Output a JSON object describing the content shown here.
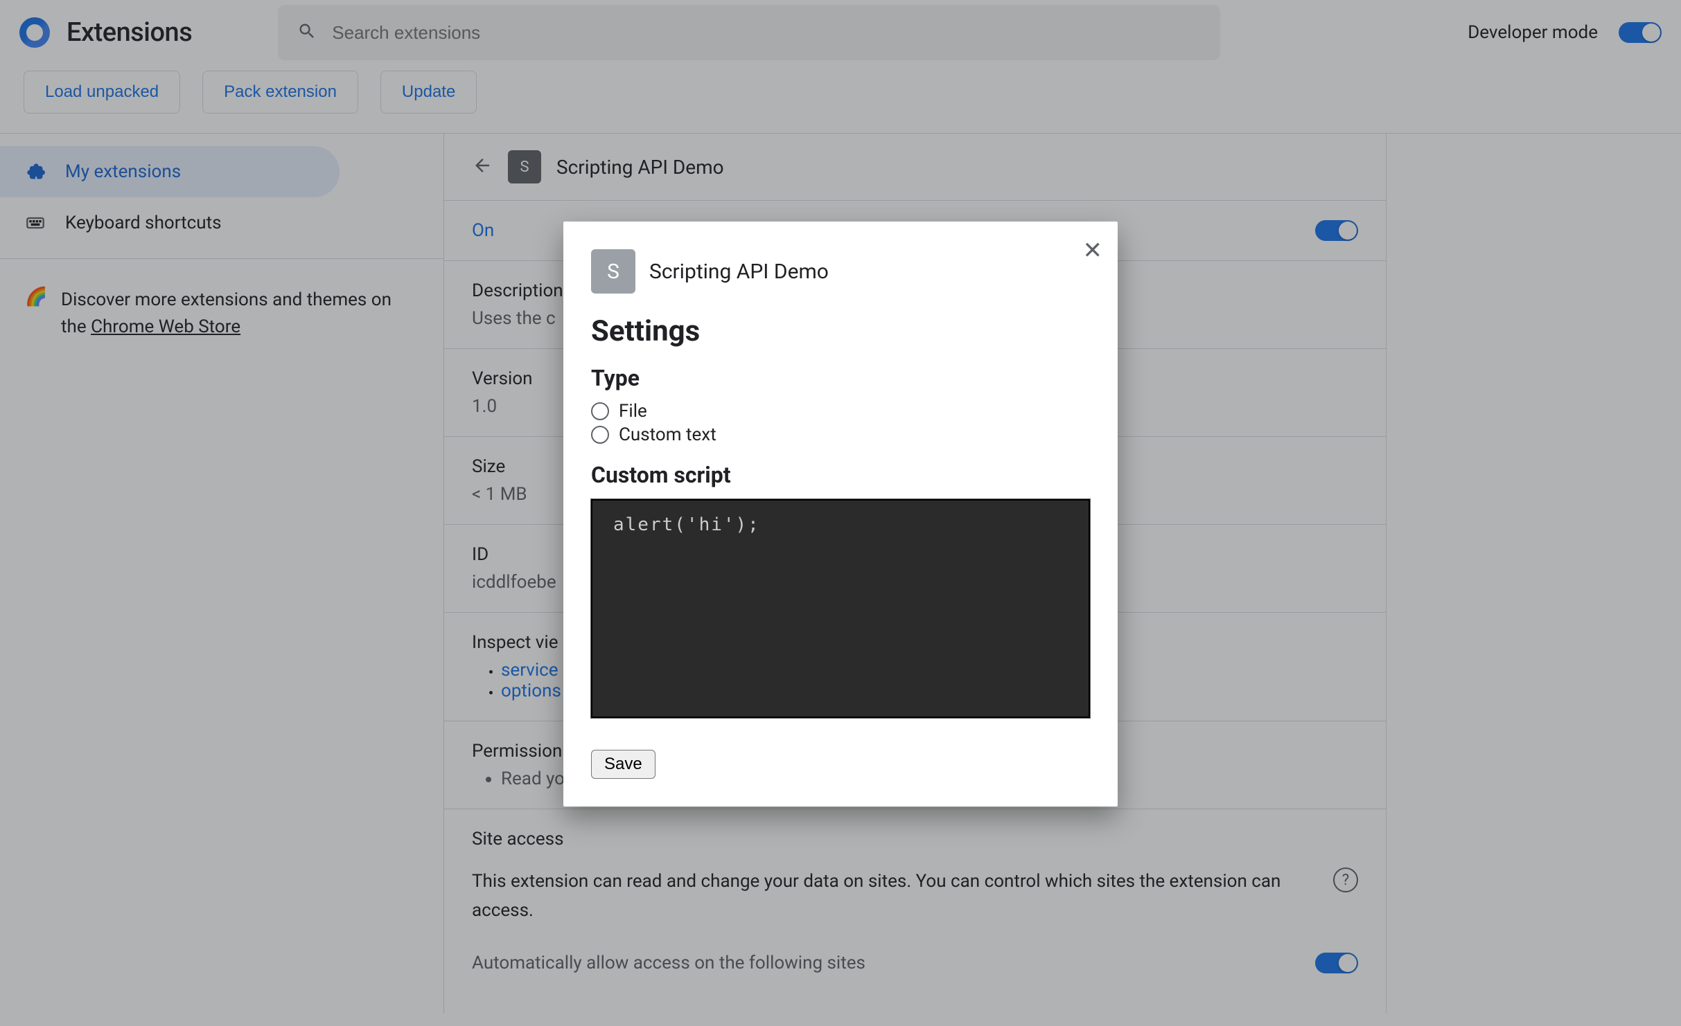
{
  "header": {
    "title": "Extensions",
    "search_placeholder": "Search extensions",
    "dev_mode_label": "Developer mode"
  },
  "buttons": {
    "load_unpacked": "Load unpacked",
    "pack_extension": "Pack extension",
    "update": "Update"
  },
  "sidebar": {
    "my_extensions": "My extensions",
    "keyboard_shortcuts": "Keyboard shortcuts",
    "cws_prefix": "Discover more extensions and themes on the ",
    "cws_link": "Chrome Web Store"
  },
  "detail": {
    "name": "Scripting API Demo",
    "badge_letter": "S",
    "on_label": "On",
    "description_label": "Description",
    "description_value": "Uses the c",
    "version_label": "Version",
    "version_value": "1.0",
    "size_label": "Size",
    "size_value": "< 1 MB",
    "id_label": "ID",
    "id_value": "icddlfoebe",
    "inspect_label": "Inspect vie",
    "inspect_items": [
      "service",
      "options"
    ],
    "permissions_label": "Permission",
    "permissions_item": "Read yo",
    "site_access_label": "Site access",
    "site_access_text": "This extension can read and change your data on sites. You can control which sites the extension can access.",
    "auto_allow_label": "Automatically allow access on the following sites"
  },
  "dialog": {
    "badge_letter": "S",
    "name": "Scripting API Demo",
    "title": "Settings",
    "type_heading": "Type",
    "type_file": "File",
    "type_custom": "Custom text",
    "script_heading": "Custom script",
    "script_value": "alert('hi');",
    "save": "Save"
  }
}
